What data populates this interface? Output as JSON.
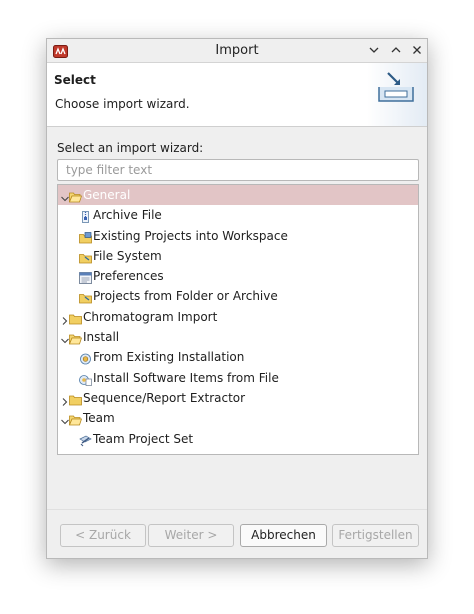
{
  "window": {
    "title": "Import",
    "controls": [
      "chevron-down-icon",
      "chevron-up-icon",
      "close-icon"
    ]
  },
  "header": {
    "title": "Select",
    "description": "Choose import wizard.",
    "banner_icon": "import-tray-icon"
  },
  "wizard": {
    "label": "Select an import wizard:",
    "filter_placeholder": "type filter text",
    "filter_value": ""
  },
  "tree": {
    "items": [
      {
        "label": "General",
        "level": 0,
        "expanded": true,
        "selected": true,
        "icon": "folder-open-icon"
      },
      {
        "label": "Archive File",
        "level": 1,
        "icon": "archive-file-icon"
      },
      {
        "label": "Existing Projects into Workspace",
        "level": 1,
        "icon": "existing-projects-icon"
      },
      {
        "label": "File System",
        "level": 1,
        "icon": "folder-icon"
      },
      {
        "label": "Preferences",
        "level": 1,
        "icon": "preferences-icon"
      },
      {
        "label": "Projects from Folder or Archive",
        "level": 1,
        "icon": "folder-icon"
      },
      {
        "label": "Chromatogram Import",
        "level": 0,
        "expanded": false,
        "icon": "folder-closed-icon"
      },
      {
        "label": "Install",
        "level": 0,
        "expanded": true,
        "icon": "folder-open-icon"
      },
      {
        "label": "From Existing Installation",
        "level": 1,
        "icon": "installation-icon"
      },
      {
        "label": "Install Software Items from File",
        "level": 1,
        "icon": "install-software-icon"
      },
      {
        "label": "Sequence/Report Extractor",
        "level": 0,
        "expanded": false,
        "icon": "folder-closed-icon"
      },
      {
        "label": "Team",
        "level": 0,
        "expanded": true,
        "icon": "folder-open-icon"
      },
      {
        "label": "Team Project Set",
        "level": 1,
        "icon": "team-project-set-icon"
      }
    ]
  },
  "buttons": {
    "back": "< Zurück",
    "next": "Weiter >",
    "cancel": "Abbrechen",
    "finish": "Fertigstellen"
  },
  "colors": {
    "selection": "#e2c5c6",
    "window_bg": "#efefef",
    "folder": "#e8c04a"
  }
}
